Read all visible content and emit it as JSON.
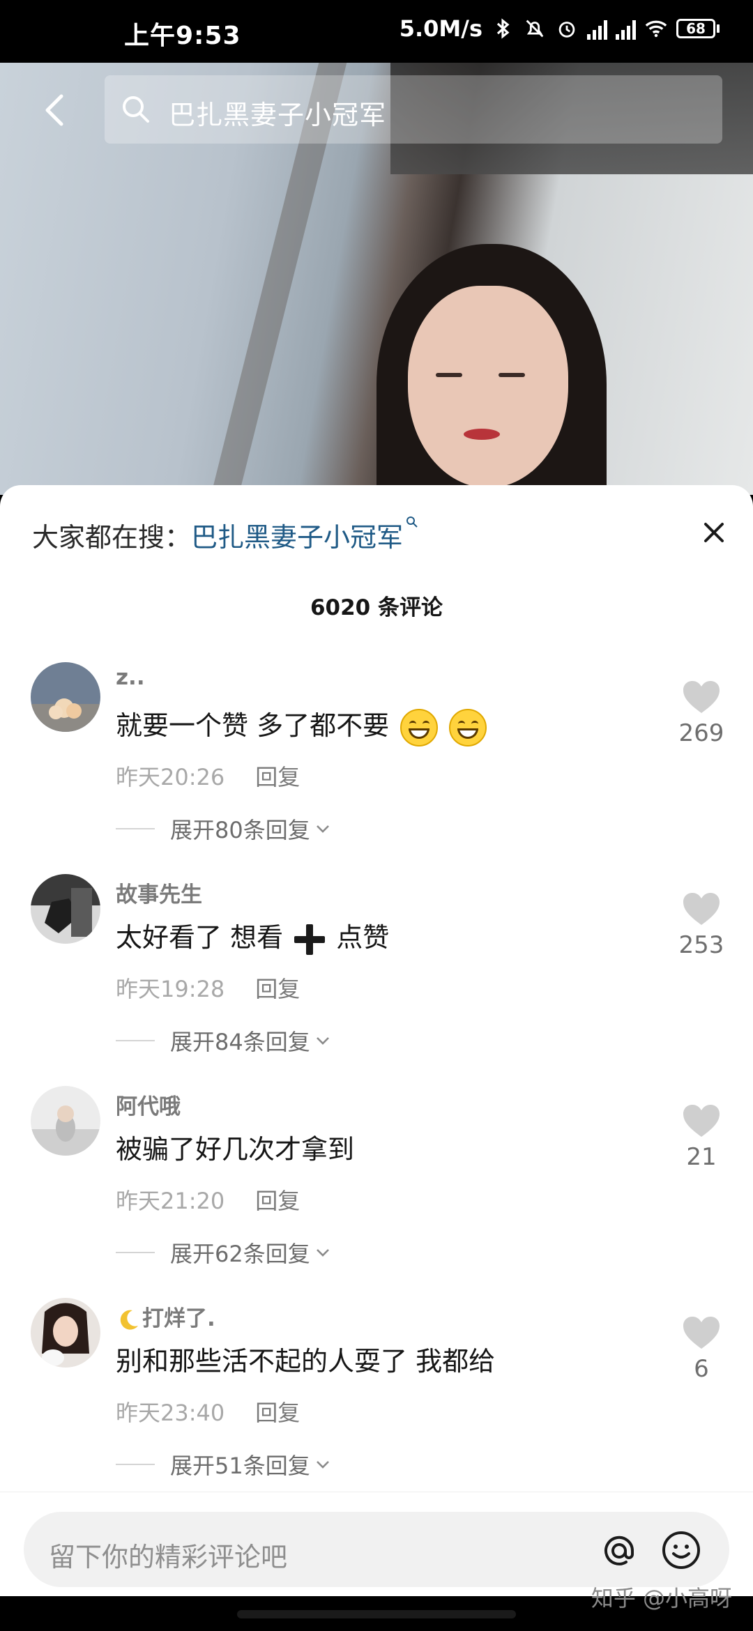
{
  "status_bar": {
    "time": "上午9:53",
    "network_speed": "5.0M/s",
    "battery": "68"
  },
  "search": {
    "query": "巴扎黑妻子小冠军"
  },
  "sheet": {
    "trending_prefix": "大家都在搜：",
    "trending_term": "巴扎黑妻子小冠军",
    "comment_count": "6020 条评论",
    "reply_label": "回复"
  },
  "comments": [
    {
      "username": "z..",
      "text": "就要一个赞 多了都不要",
      "time": "昨天20:26",
      "expand": "展开80条回复",
      "likes": "269"
    },
    {
      "username": "故事先生",
      "text_before": "太好看了 想看",
      "text_after": "点赞",
      "time": "昨天19:28",
      "expand": "展开84条回复",
      "likes": "253"
    },
    {
      "username": "阿代哦",
      "text": "被骗了好几次才拿到",
      "time": "昨天21:20",
      "expand": "展开62条回复",
      "likes": "21"
    },
    {
      "username": "打烊了.",
      "text": "别和那些活不起的人耍了 我都给",
      "time": "昨天23:40",
      "expand": "展开51条回复",
      "likes": "6"
    }
  ],
  "input": {
    "placeholder": "留下你的精彩评论吧"
  },
  "watermark": "知乎 @小高呀"
}
